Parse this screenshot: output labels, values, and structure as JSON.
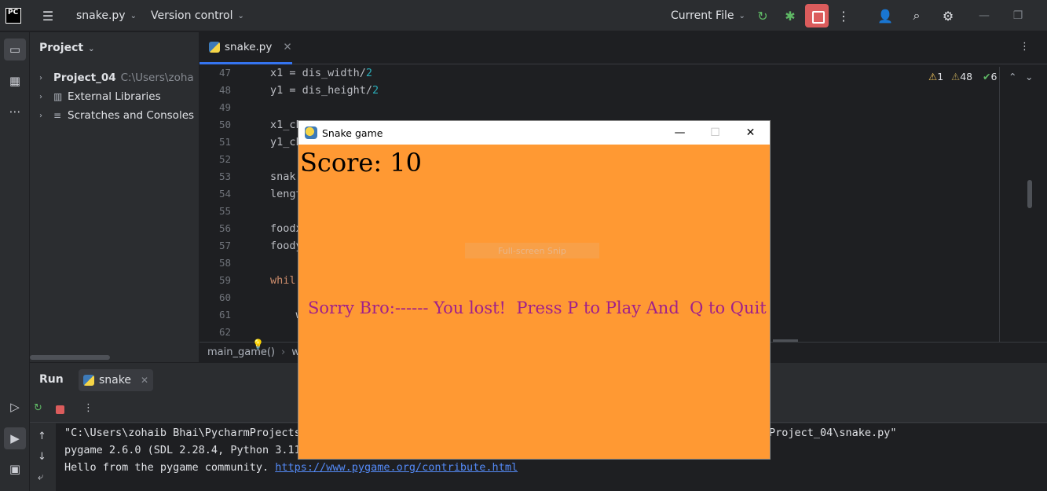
{
  "titlebar": {
    "logo": "PC",
    "file_menu": "snake.py",
    "vcs_menu": "Version control",
    "run_config": "Current File"
  },
  "icons": {
    "menu": "hamburger-icon",
    "rerun": "rerun-icon",
    "debug": "bug-icon",
    "stop": "stop-icon",
    "more": "more-icon",
    "profile": "add-user-icon",
    "search": "search-icon",
    "settings": "gear-icon"
  },
  "project": {
    "title": "Project",
    "items": [
      {
        "label": "Project_04",
        "path": "C:\\Users\\zoha"
      },
      {
        "label": "External Libraries"
      },
      {
        "label": "Scratches and Consoles"
      }
    ]
  },
  "editor": {
    "tab_label": "snake.py",
    "lines": [
      {
        "n": "47",
        "code": "x1 = dis_width/",
        "num": "2"
      },
      {
        "n": "48",
        "code": "y1 = dis_height/",
        "num": "2"
      },
      {
        "n": "49",
        "code": ""
      },
      {
        "n": "50",
        "code": "x1_ch"
      },
      {
        "n": "51",
        "code": "y1_ch"
      },
      {
        "n": "52",
        "code": ""
      },
      {
        "n": "53",
        "code": "snak"
      },
      {
        "n": "54",
        "code": "lengt"
      },
      {
        "n": "55",
        "code": ""
      },
      {
        "n": "56",
        "code": "foodx"
      },
      {
        "n": "57",
        "code": "foody"
      },
      {
        "n": "58",
        "code": ""
      },
      {
        "n": "59",
        "code": "whil",
        "kw": true
      },
      {
        "n": "60",
        "code": ""
      },
      {
        "n": "61",
        "code": "    w"
      },
      {
        "n": "62",
        "code": ""
      }
    ],
    "warnings": "1",
    "weak_warnings": "48",
    "typos": "6",
    "breadcrumb_fn": "main_game()",
    "breadcrumb_rest": "wh"
  },
  "run": {
    "title": "Run",
    "tab_label": "snake",
    "console": [
      "\"C:\\Users\\zohaib Bhai\\PycharmProjects",
      "pygame 2.6.0 (SDL 2.28.4, Python 3.11",
      "Hello from the pygame community. "
    ],
    "console_right": "Project_04\\snake.py\"",
    "link": "https://www.pygame.org/contribute.html"
  },
  "game": {
    "window_title": "Snake game",
    "score_text": "Score: 10",
    "snip_text": "Full-screen Snip",
    "message": "Sorry Bro:------ You lost!  Press P to Play And  Q to Quit",
    "background": "#ff9933",
    "message_color": "#a0208a"
  }
}
